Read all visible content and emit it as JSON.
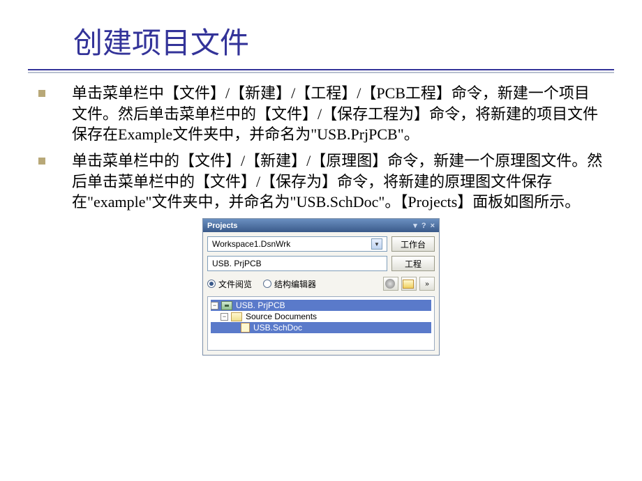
{
  "title": "创建项目文件",
  "bullets": [
    "单击菜单栏中【文件】/【新建】/【工程】/【PCB工程】命令，新建一个项目文件。然后单击菜单栏中的【文件】/【保存工程为】命令，将新建的项目文件保存在Example文件夹中，并命名为\"USB.PrjPCB\"。",
    "单击菜单栏中的【文件】/【新建】/【原理图】命令，新建一个原理图文件。然后单击菜单栏中的【文件】/【保存为】命令，将新建的原理图文件保存在\"example\"文件夹中，并命名为\"USB.SchDoc\"。【Projects】面板如图所示。"
  ],
  "panel": {
    "title": "Projects",
    "workspace": "Workspace1.DsnWrk",
    "workspace_button": "工作台",
    "project": "USB. PrjPCB",
    "project_button": "工程",
    "radio1": "文件阅览",
    "radio2": "结构编辑器",
    "tree": {
      "root": "USB. PrjPCB",
      "folder": "Source Documents",
      "file": "USB.SchDoc"
    },
    "close": "×"
  }
}
